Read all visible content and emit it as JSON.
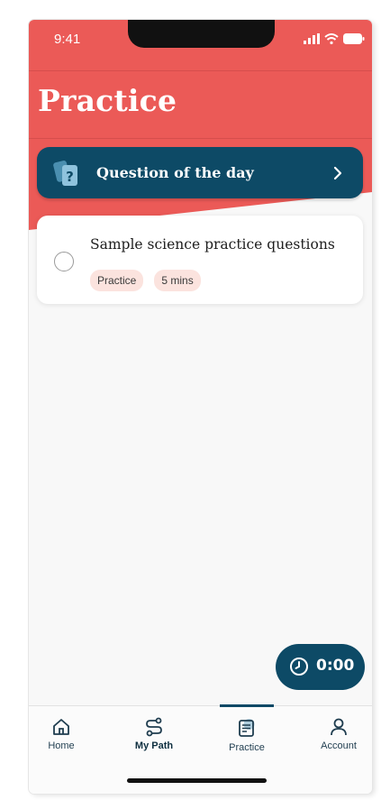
{
  "status_bar": {
    "time": "9:41",
    "icons": [
      "signal-icon",
      "wifi-icon",
      "battery-icon"
    ]
  },
  "header": {
    "title": "Practice"
  },
  "question_of_day": {
    "label": "Question of the day",
    "icon": "cards-question-icon",
    "chevron": "chevron-right-icon"
  },
  "practice_card": {
    "title": "Sample science practice questions",
    "tags": [
      "Practice",
      "5 mins"
    ],
    "selected": false
  },
  "timer": {
    "value": "0:00",
    "icon": "clock-icon"
  },
  "tabbar": {
    "items": [
      {
        "label": "Home",
        "icon": "home-icon"
      },
      {
        "label": "My Path",
        "icon": "path-icon"
      },
      {
        "label": "Practice",
        "icon": "practice-icon"
      },
      {
        "label": "Account",
        "icon": "account-icon"
      }
    ],
    "active": "Practice"
  },
  "colors": {
    "header_red": "#eb5a57",
    "navy": "#0d4a66",
    "chip_bg": "#fbe3de",
    "background": "#f8f8f8"
  }
}
